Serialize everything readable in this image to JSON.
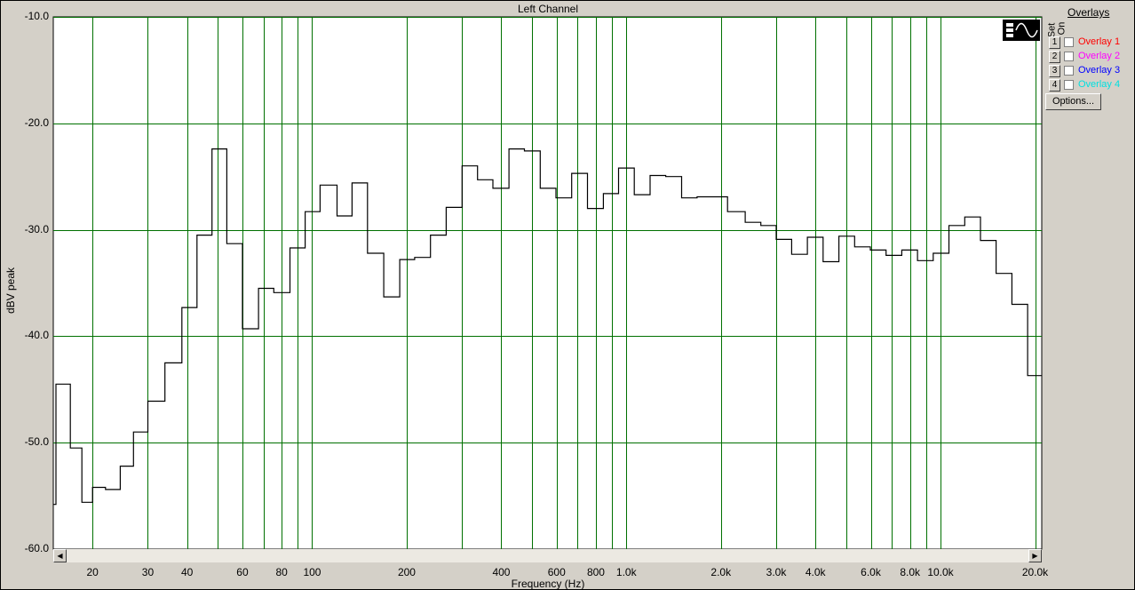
{
  "window": {
    "title": "Left Channel"
  },
  "overlays": {
    "title": "Overlays",
    "set_label": "Set",
    "on_label": "On",
    "options_label": "Options...",
    "items": [
      {
        "num": "1",
        "label": "Overlay 1",
        "color": "#ff0000",
        "checked": false
      },
      {
        "num": "2",
        "label": "Overlay 2",
        "color": "#ff00ff",
        "checked": false
      },
      {
        "num": "3",
        "label": "Overlay 3",
        "color": "#0000ff",
        "checked": false
      },
      {
        "num": "4",
        "label": "Overlay 4",
        "color": "#00e0e0",
        "checked": false
      }
    ]
  },
  "chart_data": {
    "type": "line",
    "title": "Left Channel",
    "xlabel": "Frequency (Hz)",
    "ylabel": "dBV peak",
    "xscale": "log",
    "xlim": [
      15,
      21000
    ],
    "ylim": [
      -60,
      -10
    ],
    "step": true,
    "grid": true,
    "grid_color": "#007000",
    "line_color": "#000000",
    "background": "#ffffff",
    "yticks": [
      {
        "value": -10,
        "label": "-10.0"
      },
      {
        "value": -20,
        "label": "-20.0"
      },
      {
        "value": -30,
        "label": "-30.0"
      },
      {
        "value": -40,
        "label": "-40.0"
      },
      {
        "value": -50,
        "label": "-50.0"
      },
      {
        "value": -60,
        "label": "-60.0"
      }
    ],
    "xgrid": [
      20,
      30,
      40,
      50,
      60,
      70,
      80,
      90,
      100,
      200,
      300,
      400,
      500,
      600,
      700,
      800,
      900,
      1000,
      2000,
      3000,
      4000,
      5000,
      6000,
      7000,
      8000,
      9000,
      10000,
      20000
    ],
    "xticks": [
      {
        "value": 20,
        "label": "20"
      },
      {
        "value": 30,
        "label": "30"
      },
      {
        "value": 40,
        "label": "40"
      },
      {
        "value": 60,
        "label": "60"
      },
      {
        "value": 80,
        "label": "80"
      },
      {
        "value": 100,
        "label": "100"
      },
      {
        "value": 200,
        "label": "200"
      },
      {
        "value": 400,
        "label": "400"
      },
      {
        "value": 600,
        "label": "600"
      },
      {
        "value": 800,
        "label": "800"
      },
      {
        "value": 1000,
        "label": "1.0k"
      },
      {
        "value": 2000,
        "label": "2.0k"
      },
      {
        "value": 3000,
        "label": "3.0k"
      },
      {
        "value": 4000,
        "label": "4.0k"
      },
      {
        "value": 6000,
        "label": "6.0k"
      },
      {
        "value": 8000,
        "label": "8.0k"
      },
      {
        "value": 10000,
        "label": "10.0k"
      },
      {
        "value": 20000,
        "label": "20.0k"
      }
    ],
    "series": [
      {
        "points": [
          [
            15,
            -55.8
          ],
          [
            15.3,
            -44.5
          ],
          [
            17,
            -50.5
          ],
          [
            18.5,
            -55.6
          ],
          [
            20,
            -54.2
          ],
          [
            22,
            -54.4
          ],
          [
            24.5,
            -52.2
          ],
          [
            27,
            -49
          ],
          [
            30,
            -46.1
          ],
          [
            34,
            -42.5
          ],
          [
            38.5,
            -37.3
          ],
          [
            43,
            -30.5
          ],
          [
            48,
            -22.4
          ],
          [
            53.5,
            -31.3
          ],
          [
            60,
            -39.3
          ],
          [
            67.5,
            -35.5
          ],
          [
            75.5,
            -35.9
          ],
          [
            85,
            -31.7
          ],
          [
            95,
            -28.3
          ],
          [
            106,
            -25.8
          ],
          [
            120,
            -28.7
          ],
          [
            134,
            -25.6
          ],
          [
            150,
            -32.2
          ],
          [
            169,
            -36.3
          ],
          [
            190,
            -32.8
          ],
          [
            212,
            -32.6
          ],
          [
            238,
            -30.5
          ],
          [
            267,
            -27.9
          ],
          [
            300,
            -24
          ],
          [
            336,
            -25.3
          ],
          [
            376,
            -26.1
          ],
          [
            423,
            -22.4
          ],
          [
            474,
            -22.6
          ],
          [
            532,
            -26.1
          ],
          [
            597,
            -27
          ],
          [
            670,
            -24.7
          ],
          [
            752,
            -28
          ],
          [
            845,
            -26.6
          ],
          [
            945,
            -24.2
          ],
          [
            1060,
            -26.7
          ],
          [
            1190,
            -24.9
          ],
          [
            1335,
            -25
          ],
          [
            1500,
            -27
          ],
          [
            1680,
            -26.9
          ],
          [
            2100,
            -28.3
          ],
          [
            2390,
            -29.3
          ],
          [
            2680,
            -29.6
          ],
          [
            3000,
            -30.9
          ],
          [
            3360,
            -32.3
          ],
          [
            3770,
            -30.7
          ],
          [
            4230,
            -33
          ],
          [
            4750,
            -30.6
          ],
          [
            5330,
            -31.6
          ],
          [
            5980,
            -31.9
          ],
          [
            6710,
            -32.4
          ],
          [
            7530,
            -31.9
          ],
          [
            8450,
            -32.9
          ],
          [
            9480,
            -32.2
          ],
          [
            10640,
            -29.6
          ],
          [
            11940,
            -28.8
          ],
          [
            13400,
            -31
          ],
          [
            15030,
            -34.1
          ],
          [
            16870,
            -37
          ],
          [
            18930,
            -43.7
          ],
          [
            21000,
            -43.7
          ]
        ]
      }
    ]
  }
}
